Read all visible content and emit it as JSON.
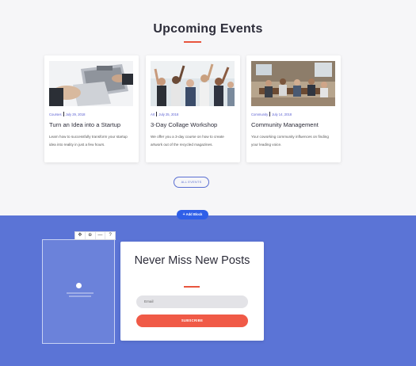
{
  "events": {
    "title": "Upcoming Events",
    "cards": [
      {
        "category": "Courses",
        "date": "July 29, 2018",
        "title": "Turn an Idea into a Startup",
        "description": "Learn how to successfully transform your startup idea into reality in just a few hours."
      },
      {
        "category": "Art",
        "date": "July 25, 2018",
        "title": "3-Day Collage Workshop",
        "description": "We offer you a 3-day course on how to create artwork out of the recycled magazines."
      },
      {
        "category": "Community",
        "date": "July 14, 2018",
        "title": "Community Management",
        "description": "Your coworking community influences on finding your leading voice."
      }
    ],
    "all_events_label": "ALL EVENTS"
  },
  "editor": {
    "add_block_label": "Add Block",
    "toolbar": [
      "✥",
      "⊕",
      "—",
      "?"
    ]
  },
  "newsletter": {
    "title": "Never Miss New Posts",
    "email_placeholder": "Email",
    "subscribe_label": "SUBSCRIBE"
  },
  "colors": {
    "accent": "#e8553e",
    "link": "#5a5fd2",
    "section_bg": "#5b74d6"
  }
}
